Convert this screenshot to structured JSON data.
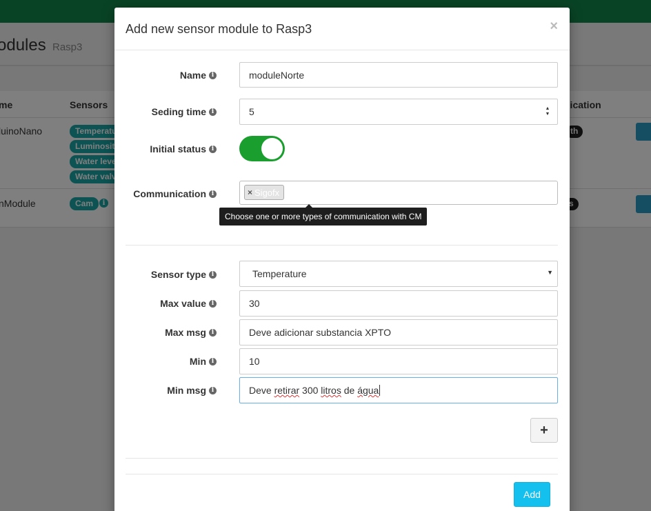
{
  "background": {
    "page_title": "odules",
    "page_subtitle": "Rasp3",
    "columns": [
      "me",
      "Sensors",
      "nication"
    ],
    "rows": [
      {
        "name": "luinoNano",
        "sensors": [
          "Temperatu",
          "Luminosit",
          "Water leve",
          "Water valv"
        ],
        "badge": "th"
      },
      {
        "name": "nModule",
        "sensors": [
          "Cam"
        ],
        "badge": "s"
      }
    ]
  },
  "modal": {
    "title": "Add new sensor module to Rasp3",
    "close_label": "×",
    "name": {
      "label": "Name",
      "value": "moduleNorte"
    },
    "sending_time": {
      "label": "Seding time",
      "value": "5"
    },
    "initial_status": {
      "label": "Initial status",
      "on": true
    },
    "communication": {
      "label": "Communication",
      "tags": [
        "Sigofx"
      ],
      "tooltip": "Choose one or more types of communication with CM"
    },
    "sensor_type": {
      "label": "Sensor type",
      "value": "Temperature"
    },
    "max_value": {
      "label": "Max value",
      "value": "30"
    },
    "max_msg": {
      "label": "Max msg",
      "value": "Deve adicionar substancia XPTO"
    },
    "min": {
      "label": "Min",
      "value": "10"
    },
    "min_msg": {
      "label": "Min msg",
      "parts": [
        "Deve ",
        "retirar",
        " 300 ",
        "litros",
        " de ",
        "água"
      ]
    },
    "plus_label": "+",
    "add_label": "Add"
  },
  "colors": {
    "topbar": "#13874a",
    "toggle_on": "#1a9e2e",
    "add_button": "#14c0ee",
    "tag_teal": "#1aa6a6"
  },
  "icons": {
    "info": "info-icon",
    "plus": "plus-icon",
    "close": "close-icon",
    "select": "caret-down-icon",
    "stepper": "spin-icon"
  }
}
